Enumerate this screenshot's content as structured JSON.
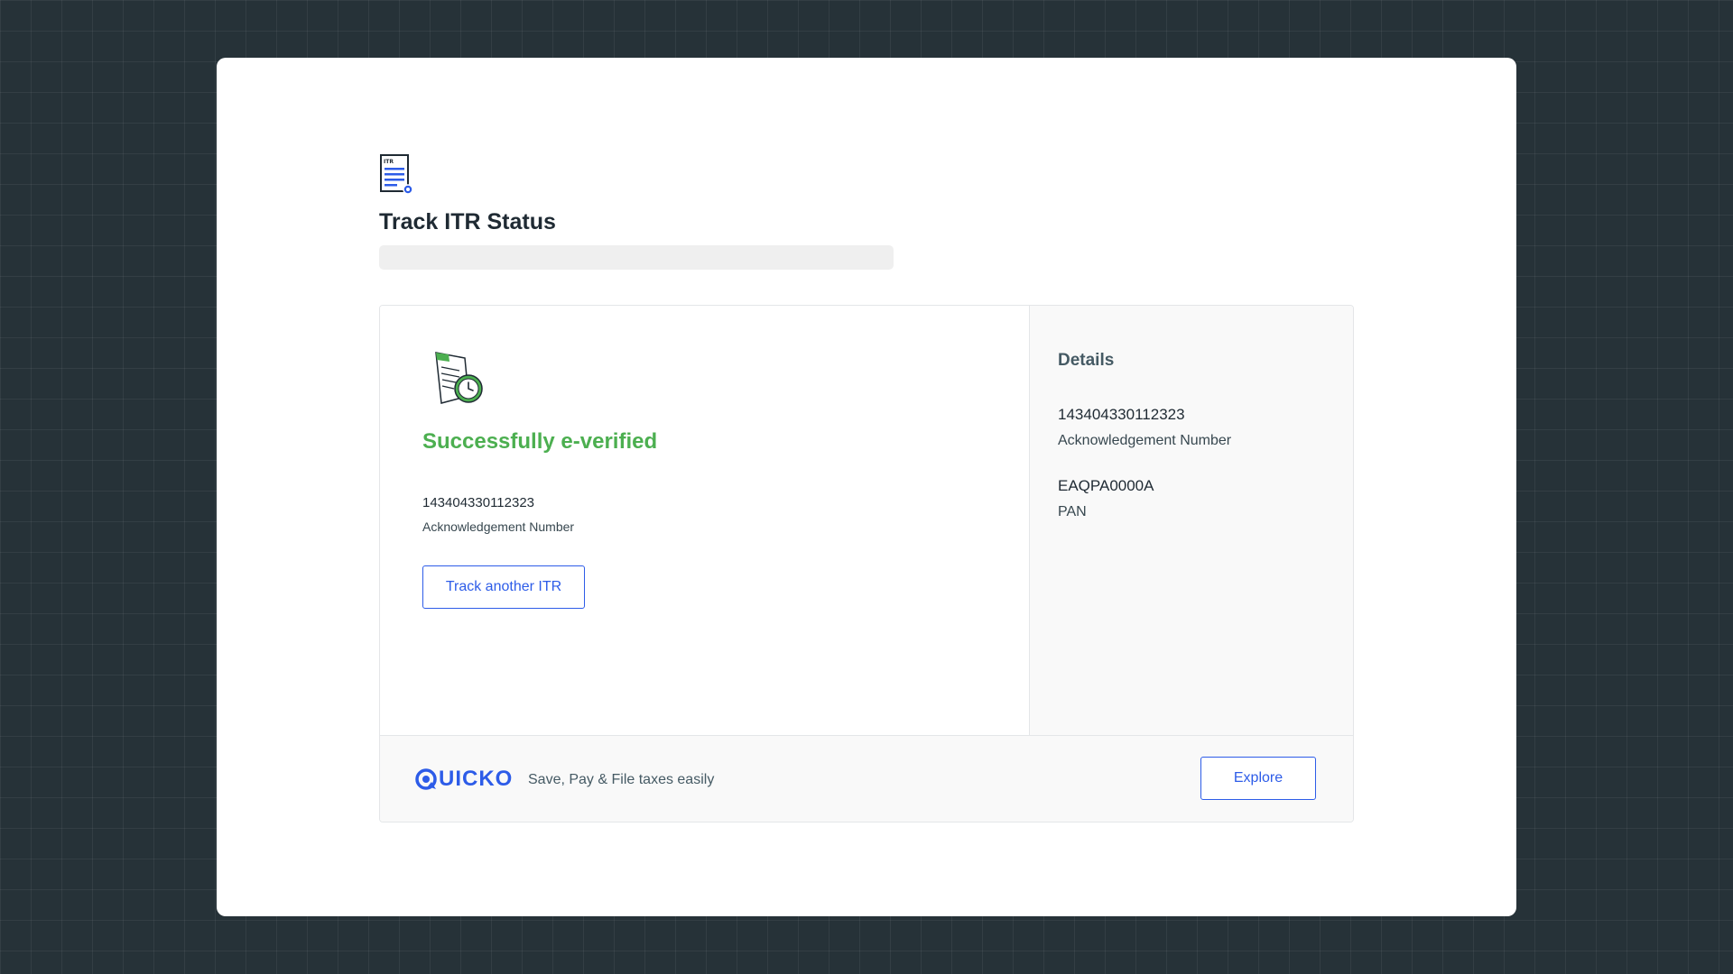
{
  "header": {
    "icon": "itr-document-icon",
    "icon_text": "ITR",
    "title": "Track ITR Status"
  },
  "status": {
    "icon": "verified-document-clock-icon",
    "title": "Successfully e-verified",
    "acknowledgement_number": "143404330112323",
    "acknowledgement_label": "Acknowledgement Number",
    "track_button_label": "Track another ITR"
  },
  "details": {
    "title": "Details",
    "items": [
      {
        "value": "143404330112323",
        "label": "Acknowledgement Number"
      },
      {
        "value": "EAQPA0000A",
        "label": "PAN"
      }
    ]
  },
  "footer": {
    "brand_icon": "quicko-q-icon",
    "brand_rest": "UICKO",
    "tagline": "Save, Pay & File taxes easily",
    "explore_button_label": "Explore"
  },
  "colors": {
    "background": "#263238",
    "accent_blue": "#2d5ce8",
    "success_green": "#4caf50"
  }
}
